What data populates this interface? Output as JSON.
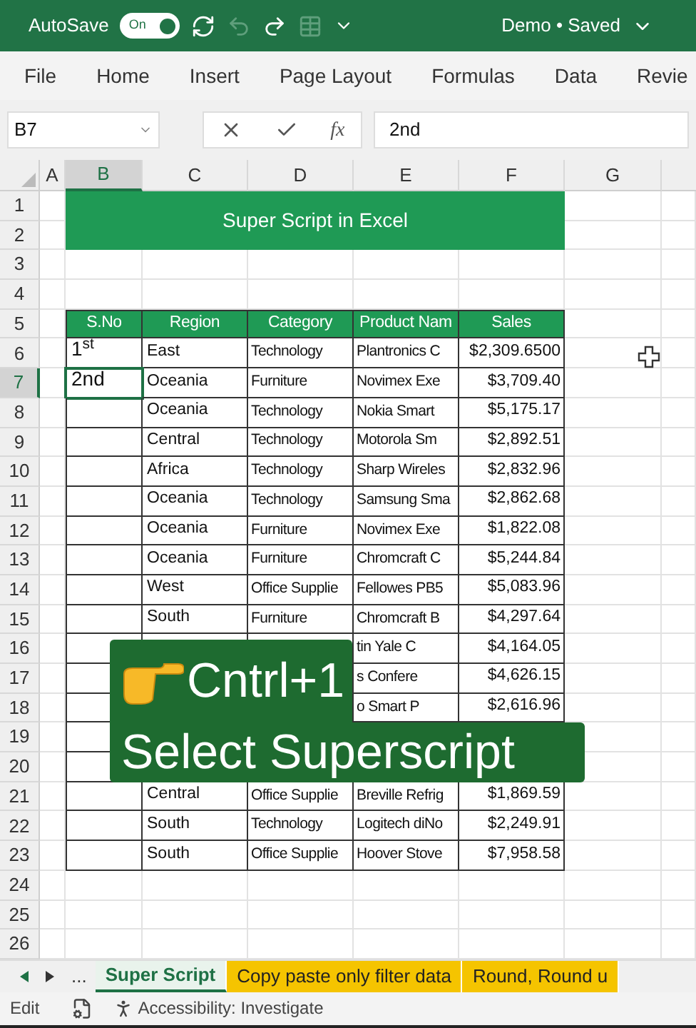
{
  "title_bar": {
    "autosave_label": "AutoSave",
    "autosave": {
      "label": "On",
      "on": true
    },
    "document_title": "Demo • Saved"
  },
  "ribbon_tabs": [
    {
      "label": "File"
    },
    {
      "label": "Home"
    },
    {
      "label": "Insert"
    },
    {
      "label": "Page Layout"
    },
    {
      "label": "Formulas"
    },
    {
      "label": "Data"
    },
    {
      "label": "Revie"
    }
  ],
  "formula_bar": {
    "name_box": "B7",
    "function_label": "fx",
    "formula": "2nd"
  },
  "columns": [
    {
      "label": "A",
      "selected": false
    },
    {
      "label": "B",
      "selected": true
    },
    {
      "label": "C",
      "selected": false
    },
    {
      "label": "D",
      "selected": false
    },
    {
      "label": "E",
      "selected": false
    },
    {
      "label": "F",
      "selected": false
    },
    {
      "label": "G",
      "selected": false
    }
  ],
  "rows": [
    {
      "label": "1",
      "selected": false
    },
    {
      "label": "2",
      "selected": false
    },
    {
      "label": "3",
      "selected": false
    },
    {
      "label": "4",
      "selected": false
    },
    {
      "label": "5",
      "selected": false
    },
    {
      "label": "6",
      "selected": false
    },
    {
      "label": "7",
      "selected": true
    },
    {
      "label": "8",
      "selected": false
    },
    {
      "label": "9",
      "selected": false
    },
    {
      "label": "10",
      "selected": false
    },
    {
      "label": "11",
      "selected": false
    },
    {
      "label": "12",
      "selected": false
    },
    {
      "label": "13",
      "selected": false
    },
    {
      "label": "14",
      "selected": false
    },
    {
      "label": "15",
      "selected": false
    },
    {
      "label": "16",
      "selected": false
    },
    {
      "label": "17",
      "selected": false
    },
    {
      "label": "18",
      "selected": false
    },
    {
      "label": "19",
      "selected": false
    },
    {
      "label": "20",
      "selected": false
    },
    {
      "label": "21",
      "selected": false
    },
    {
      "label": "22",
      "selected": false
    },
    {
      "label": "23",
      "selected": false
    },
    {
      "label": "24",
      "selected": false
    },
    {
      "label": "25",
      "selected": false
    },
    {
      "label": "26",
      "selected": false
    }
  ],
  "title_cell": "Super Script in Excel",
  "table": {
    "columns": [
      "S.No",
      "Region",
      "Category",
      "Product Nam",
      "Sales"
    ],
    "rows": [
      [
        "1$^{st}$",
        "East",
        "Technology",
        "Plantronics C",
        "$2,309.6500"
      ],
      [
        "2nd",
        "Oceania",
        "Furniture",
        "Novimex Exe",
        "$3,709.40"
      ],
      [
        null,
        "Oceania",
        "Technology",
        "Nokia Smart",
        "$5,175.17"
      ],
      [
        null,
        "Central",
        "Technology",
        "Motorola Sm",
        "$2,892.51"
      ],
      [
        null,
        "Africa",
        "Technology",
        "Sharp Wireles",
        "$2,832.96"
      ],
      [
        null,
        "Oceania",
        "Technology",
        "Samsung Sma",
        "$2,862.68"
      ],
      [
        null,
        "Oceania",
        "Furniture",
        "Novimex Exe",
        "$1,822.08"
      ],
      [
        null,
        "Oceania",
        "Furniture",
        "Chromcraft C",
        "$5,244.84"
      ],
      [
        null,
        "West",
        "Office Supplie",
        "Fellowes PB5",
        "$5,083.96"
      ],
      [
        null,
        "South",
        "Furniture",
        "Chromcraft B",
        "$4,297.64"
      ],
      [
        null,
        null,
        null,
        "tin Yale C",
        "$4,164.05"
      ],
      [
        null,
        null,
        null,
        "s Confere",
        "$4,626.15"
      ],
      [
        null,
        null,
        null,
        "o Smart P",
        "$2,616.96"
      ],
      [
        null,
        null,
        null,
        null,
        null
      ],
      [
        null,
        null,
        null,
        null,
        null
      ],
      [
        null,
        "Central",
        "Office Supplie",
        "Breville Refrig",
        "$1,869.59"
      ],
      [
        null,
        "South",
        "Technology",
        "Logitech diNo",
        "$2,249.91"
      ],
      [
        null,
        "South",
        "Office Supplie",
        "Hoover Stove",
        "$7,958.58"
      ]
    ]
  },
  "overlay": {
    "line_1": "Cntrl+1",
    "line_2": "Select Superscript"
  },
  "sheet_tabs": {
    "more": "...",
    "tabs": [
      {
        "label": "Super Script",
        "selected": true,
        "color": "#1e7145"
      },
      {
        "label": "Copy paste only filter data",
        "selected": false,
        "color": "#f5c400"
      },
      {
        "label": "Round, Round u",
        "selected": false,
        "color": "#f5c400"
      }
    ]
  },
  "status_bar": {
    "mode": "Edit",
    "accessibility": "Accessibility: Investigate"
  }
}
